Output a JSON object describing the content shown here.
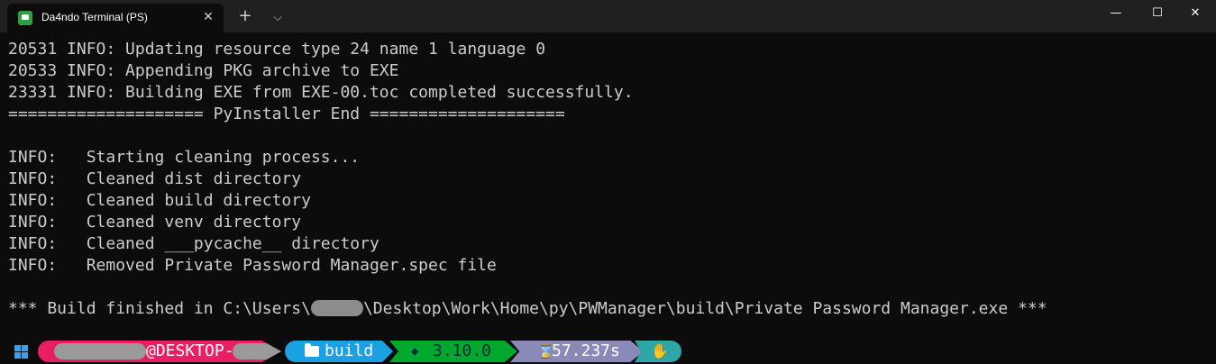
{
  "window": {
    "tab_title": "Da4ndo Terminal (PS)",
    "tab_close": "✕",
    "new_tab": "+",
    "dropdown": "⌵",
    "minimize": "—",
    "maximize": "☐",
    "close": "✕"
  },
  "terminal": {
    "lines": [
      "20531 INFO: Updating resource type 24 name 1 language 0",
      "20533 INFO: Appending PKG archive to EXE",
      "23331 INFO: Building EXE from EXE-00.toc completed successfully.",
      "==================== PyInstaller End ====================",
      "",
      "INFO:   Starting cleaning process...",
      "INFO:   Cleaned dist directory",
      "INFO:   Cleaned build directory",
      "INFO:   Cleaned venv directory",
      "INFO:   Cleaned ___pycache__ directory",
      "INFO:   Removed Private Password Manager.spec file",
      ""
    ],
    "build_line_prefix": "*** Build finished in C:\\Users\\",
    "build_line_suffix": "\\Desktop\\Work\\Home\\py\\PWManager\\build\\Private Password Manager.exe ***"
  },
  "prompt": {
    "user_host": "@DESKTOP-",
    "directory": "build",
    "python_version": "3.10.0",
    "duration": "57.237s",
    "icons": {
      "os": "windows-icon",
      "folder": "folder-icon",
      "python": "python-icon",
      "timer": "hourglass-icon",
      "hand": "hand-icon"
    }
  },
  "colors": {
    "background": "#0c0c0c",
    "text": "#cccccc",
    "user_segment": "#e91e63",
    "dir_segment": "#1ba1e2",
    "python_segment": "#00a82d",
    "time_segment": "#8a8ab8",
    "hand_segment": "#2fa6a6"
  }
}
